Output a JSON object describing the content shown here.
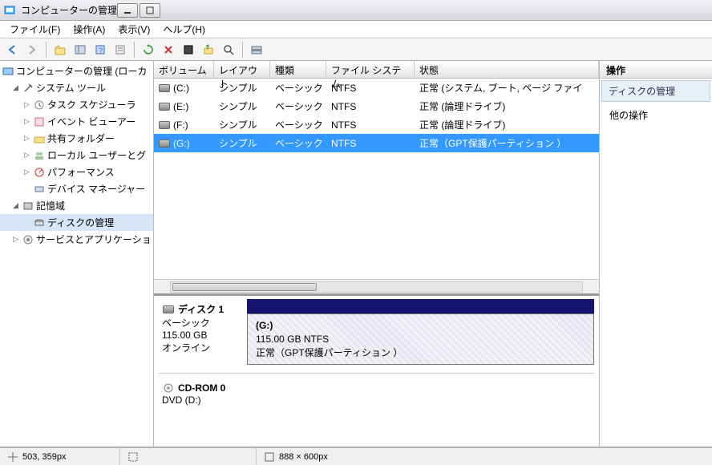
{
  "window": {
    "title": "コンピューターの管理"
  },
  "menu": {
    "file": "ファイル(F)",
    "action": "操作(A)",
    "view": "表示(V)",
    "help": "ヘルプ(H)"
  },
  "tree": {
    "root": "コンピューターの管理 (ローカ",
    "systools": "システム ツール",
    "tasksched": "タスク スケジューラ",
    "eventvwr": "イベント ビューアー",
    "sharedf": "共有フォルダー",
    "localusers": "ローカル ユーザーとグ",
    "perf": "パフォーマンス",
    "devmgr": "デバイス マネージャー",
    "storage": "記憶域",
    "diskmgmt": "ディスクの管理",
    "svcs": "サービスとアプリケーショ"
  },
  "volcols": {
    "volume": "ボリューム",
    "layout": "レイアウト",
    "kind": "種類",
    "fs": "ファイル システム",
    "status": "状態"
  },
  "volumes": [
    {
      "name": "(C:)",
      "layout": "シンプル",
      "kind": "ベーシック",
      "fs": "NTFS",
      "status": "正常 (システム, ブート, ページ ファイ",
      "sel": false
    },
    {
      "name": "(E:)",
      "layout": "シンプル",
      "kind": "ベーシック",
      "fs": "NTFS",
      "status": "正常 (論理ドライブ)",
      "sel": false
    },
    {
      "name": "(F:)",
      "layout": "シンプル",
      "kind": "ベーシック",
      "fs": "NTFS",
      "status": "正常 (論理ドライブ)",
      "sel": false
    },
    {
      "name": "(G:)",
      "layout": "シンプル",
      "kind": "ベーシック",
      "fs": "NTFS",
      "status": "正常（GPT保護パーティション ）",
      "sel": true
    }
  ],
  "disk1": {
    "label": "ディスク 1",
    "type": "ベーシック",
    "size": "115.00 GB",
    "online": "オンライン",
    "partname": "(G:)",
    "partinfo": "115.00 GB NTFS",
    "partstatus": "正常（GPT保護パーティション ）"
  },
  "cdrom": {
    "label": "CD-ROM 0",
    "drive": "DVD (D:)"
  },
  "actions": {
    "header": "操作",
    "section": "ディスクの管理",
    "more": "他の操作"
  },
  "status": {
    "pos": "503, 359px",
    "dim": "888 × 600px"
  }
}
